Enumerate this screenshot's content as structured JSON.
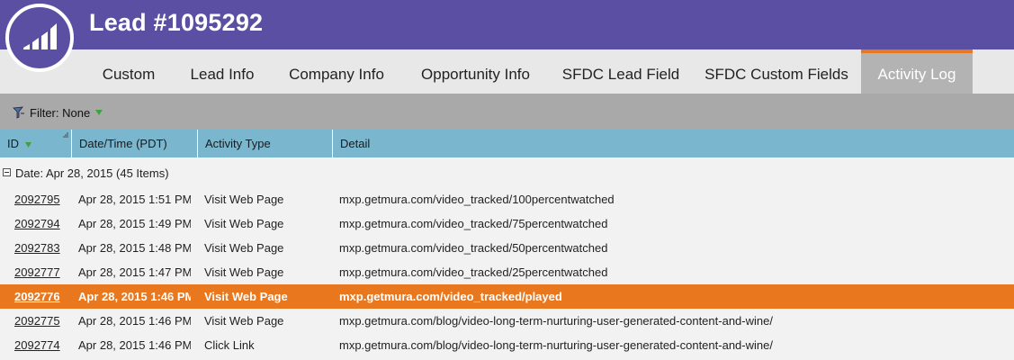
{
  "header": {
    "title": "Lead #1095292",
    "logo_icon": "marketo-bars-icon",
    "brand_color": "#5a4fa3"
  },
  "tabs": [
    {
      "label": "Custom",
      "active": false
    },
    {
      "label": "Lead Info",
      "active": false
    },
    {
      "label": "Company Info",
      "active": false
    },
    {
      "label": "Opportunity Info",
      "active": false
    },
    {
      "label": "SFDC Lead Field",
      "active": false
    },
    {
      "label": "SFDC Custom Fields",
      "active": false
    },
    {
      "label": "Activity Log",
      "active": true
    }
  ],
  "filter": {
    "label": "Filter: None",
    "icon": "funnel-icon",
    "arrow_icon": "triangle-down-icon"
  },
  "columns": [
    {
      "label": "ID",
      "sort_icon": "sort-down-icon"
    },
    {
      "label": "Date/Time (PDT)"
    },
    {
      "label": "Activity Type"
    },
    {
      "label": "Detail"
    }
  ],
  "group": {
    "label": "Date: Apr 28, 2015 (45 Items)",
    "icon": "collapse-minus-icon"
  },
  "rows": [
    {
      "id": "2092795",
      "datetime": "Apr 28, 2015 1:51 PM",
      "type": "Visit Web Page",
      "detail": "mxp.getmura.com/video_tracked/100percentwatched",
      "selected": false
    },
    {
      "id": "2092794",
      "datetime": "Apr 28, 2015 1:49 PM",
      "type": "Visit Web Page",
      "detail": "mxp.getmura.com/video_tracked/75percentwatched",
      "selected": false
    },
    {
      "id": "2092783",
      "datetime": "Apr 28, 2015 1:48 PM",
      "type": "Visit Web Page",
      "detail": "mxp.getmura.com/video_tracked/50percentwatched",
      "selected": false
    },
    {
      "id": "2092777",
      "datetime": "Apr 28, 2015 1:47 PM",
      "type": "Visit Web Page",
      "detail": "mxp.getmura.com/video_tracked/25percentwatched",
      "selected": false
    },
    {
      "id": "2092776",
      "datetime": "Apr 28, 2015 1:46 PM",
      "type": "Visit Web Page",
      "detail": "mxp.getmura.com/video_tracked/played",
      "selected": true
    },
    {
      "id": "2092775",
      "datetime": "Apr 28, 2015 1:46 PM",
      "type": "Visit Web Page",
      "detail": "mxp.getmura.com/blog/video-long-term-nurturing-user-generated-content-and-wine/",
      "selected": false
    },
    {
      "id": "2092774",
      "datetime": "Apr 28, 2015 1:46 PM",
      "type": "Click Link",
      "detail": "mxp.getmura.com/blog/video-long-term-nurturing-user-generated-content-and-wine/",
      "selected": false
    }
  ],
  "colors": {
    "selected_row": "#e8771e",
    "column_header": "#7ab7cf",
    "filter_bar": "#a9a9a9",
    "active_tab": "#b3b3b3",
    "active_tab_accent": "#e87722"
  }
}
